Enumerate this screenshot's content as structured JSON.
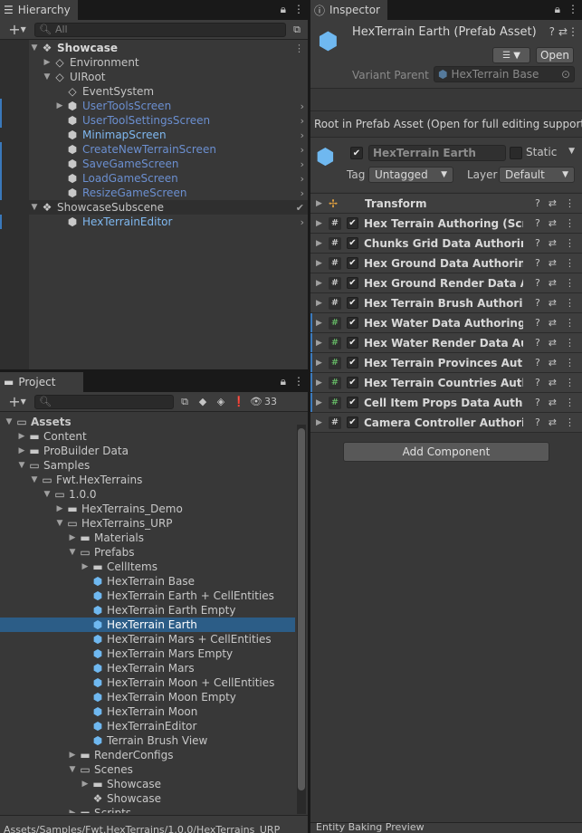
{
  "hierarchy": {
    "tab_label": "Hierarchy",
    "search_placeholder": "All",
    "add_label": "+",
    "rows": [
      {
        "label": "Showcase",
        "indent": 0,
        "arrow": "▼",
        "icon": "scene",
        "style": "bold"
      },
      {
        "label": "Environment",
        "indent": 1,
        "arrow": "▶",
        "icon": "cube",
        "style": ""
      },
      {
        "label": "UIRoot",
        "indent": 1,
        "arrow": "▼",
        "icon": "cube",
        "style": ""
      },
      {
        "label": "EventSystem",
        "indent": 2,
        "arrow": "",
        "icon": "cube",
        "style": ""
      },
      {
        "label": "UserToolsScreen",
        "indent": 2,
        "arrow": "▶",
        "icon": "prefab",
        "style": "blue",
        "chev": true,
        "marker": true
      },
      {
        "label": "UserToolSettingsScreen",
        "indent": 2,
        "arrow": "",
        "icon": "prefab",
        "style": "blue",
        "chev": true,
        "marker": true
      },
      {
        "label": "MinimapScreen",
        "indent": 2,
        "arrow": "",
        "icon": "prefab",
        "style": "cyan",
        "chev": true
      },
      {
        "label": "CreateNewTerrainScreen",
        "indent": 2,
        "arrow": "",
        "icon": "prefab",
        "style": "blue",
        "chev": true,
        "marker": true
      },
      {
        "label": "SaveGameScreen",
        "indent": 2,
        "arrow": "",
        "icon": "prefab",
        "style": "blue",
        "chev": true,
        "marker": true
      },
      {
        "label": "LoadGameScreen",
        "indent": 2,
        "arrow": "",
        "icon": "prefab",
        "style": "blue",
        "chev": true,
        "marker": true
      },
      {
        "label": "ResizeGameScreen",
        "indent": 2,
        "arrow": "",
        "icon": "prefab",
        "style": "blue",
        "chev": true,
        "marker": true
      },
      {
        "label": "ShowcaseSubscene",
        "indent": 0,
        "arrow": "▼",
        "icon": "scene",
        "style": "",
        "check": true,
        "scene_row": true
      },
      {
        "label": "HexTerrainEditor",
        "indent": 2,
        "arrow": "",
        "icon": "prefab",
        "style": "cyan",
        "chev": true,
        "marker": true
      }
    ]
  },
  "project": {
    "tab_label": "Project",
    "add_label": "+",
    "hidden_count": "33",
    "rows": [
      {
        "label": "Assets",
        "indent": 0,
        "arrow": "▼",
        "icon": "folder-open",
        "bold": true
      },
      {
        "label": "Content",
        "indent": 1,
        "arrow": "▶",
        "icon": "folder"
      },
      {
        "label": "ProBuilder Data",
        "indent": 1,
        "arrow": "▶",
        "icon": "folder"
      },
      {
        "label": "Samples",
        "indent": 1,
        "arrow": "▼",
        "icon": "folder-open"
      },
      {
        "label": "Fwt.HexTerrains",
        "indent": 2,
        "arrow": "▼",
        "icon": "folder-open"
      },
      {
        "label": "1.0.0",
        "indent": 3,
        "arrow": "▼",
        "icon": "folder-open"
      },
      {
        "label": "HexTerrains_Demo",
        "indent": 4,
        "arrow": "▶",
        "icon": "folder"
      },
      {
        "label": "HexTerrains_URP",
        "indent": 4,
        "arrow": "▼",
        "icon": "folder-open"
      },
      {
        "label": "Materials",
        "indent": 5,
        "arrow": "▶",
        "icon": "folder"
      },
      {
        "label": "Prefabs",
        "indent": 5,
        "arrow": "▼",
        "icon": "folder-open"
      },
      {
        "label": "CellItems",
        "indent": 6,
        "arrow": "▶",
        "icon": "folder"
      },
      {
        "label": "HexTerrain Base",
        "indent": 6,
        "arrow": "",
        "icon": "prefab"
      },
      {
        "label": "HexTerrain Earth + CellEntities",
        "indent": 6,
        "arrow": "",
        "icon": "prefab-variant"
      },
      {
        "label": "HexTerrain Earth Empty",
        "indent": 6,
        "arrow": "",
        "icon": "prefab-variant"
      },
      {
        "label": "HexTerrain Earth",
        "indent": 6,
        "arrow": "",
        "icon": "prefab-variant",
        "selected": true
      },
      {
        "label": "HexTerrain Mars + CellEntities",
        "indent": 6,
        "arrow": "",
        "icon": "prefab-variant"
      },
      {
        "label": "HexTerrain Mars Empty",
        "indent": 6,
        "arrow": "",
        "icon": "prefab-variant"
      },
      {
        "label": "HexTerrain Mars",
        "indent": 6,
        "arrow": "",
        "icon": "prefab-variant"
      },
      {
        "label": "HexTerrain Moon + CellEntities",
        "indent": 6,
        "arrow": "",
        "icon": "prefab-variant"
      },
      {
        "label": "HexTerrain Moon Empty",
        "indent": 6,
        "arrow": "",
        "icon": "prefab-variant"
      },
      {
        "label": "HexTerrain Moon",
        "indent": 6,
        "arrow": "",
        "icon": "prefab-variant"
      },
      {
        "label": "HexTerrainEditor",
        "indent": 6,
        "arrow": "",
        "icon": "prefab"
      },
      {
        "label": "Terrain Brush View",
        "indent": 6,
        "arrow": "",
        "icon": "prefab"
      },
      {
        "label": "RenderConfigs",
        "indent": 5,
        "arrow": "▶",
        "icon": "folder"
      },
      {
        "label": "Scenes",
        "indent": 5,
        "arrow": "▼",
        "icon": "folder-open"
      },
      {
        "label": "Showcase",
        "indent": 6,
        "arrow": "▶",
        "icon": "folder"
      },
      {
        "label": "Showcase",
        "indent": 6,
        "arrow": "",
        "icon": "scene"
      },
      {
        "label": "Scripts",
        "indent": 5,
        "arrow": "▶",
        "icon": "folder"
      }
    ],
    "footer_path": "Assets/Samples/Fwt.HexTerrains/1.0.0/HexTerrains_URP"
  },
  "inspector": {
    "tab_label": "Inspector",
    "title": "HexTerrain Earth (Prefab Asset)",
    "open_label": "Open",
    "variant_parent_label": "Variant Parent",
    "variant_parent_value": "HexTerrain Base",
    "root_notice": "Root in Prefab Asset (Open for full editing support)",
    "object_name": "HexTerrain Earth",
    "static_label": "Static",
    "tag_label": "Tag",
    "tag_value": "Untagged",
    "layer_label": "Layer",
    "layer_value": "Default",
    "transform_label": "Transform",
    "components": [
      {
        "name": "Hex Terrain Authoring (Script)",
        "added": false
      },
      {
        "name": "Chunks Grid Data Authoring (Script)",
        "added": false
      },
      {
        "name": "Hex Ground Data Authoring (Script)",
        "added": false
      },
      {
        "name": "Hex Ground Render Data Authoring (Script)",
        "added": false
      },
      {
        "name": "Hex Terrain Brush Authoring (Script)",
        "added": false
      },
      {
        "name": "Hex Water Data Authoring (Script)",
        "added": true
      },
      {
        "name": "Hex Water Render Data Authoring (Script)",
        "added": true
      },
      {
        "name": "Hex Terrain Provinces Authoring (Script)",
        "added": true
      },
      {
        "name": "Hex Terrain Countries Authoring (Script)",
        "added": true
      },
      {
        "name": "Cell Item Props Data Authoring (Script)",
        "added": true
      },
      {
        "name": "Camera Controller Authoring (Script)",
        "added": false
      }
    ],
    "add_component_label": "Add Component",
    "footer_label": "Entity Baking Preview"
  },
  "colors": {
    "selection": "#2c5d87",
    "prefab_blue": "#6fb8f0",
    "modified_marker": "#3a79bb"
  }
}
